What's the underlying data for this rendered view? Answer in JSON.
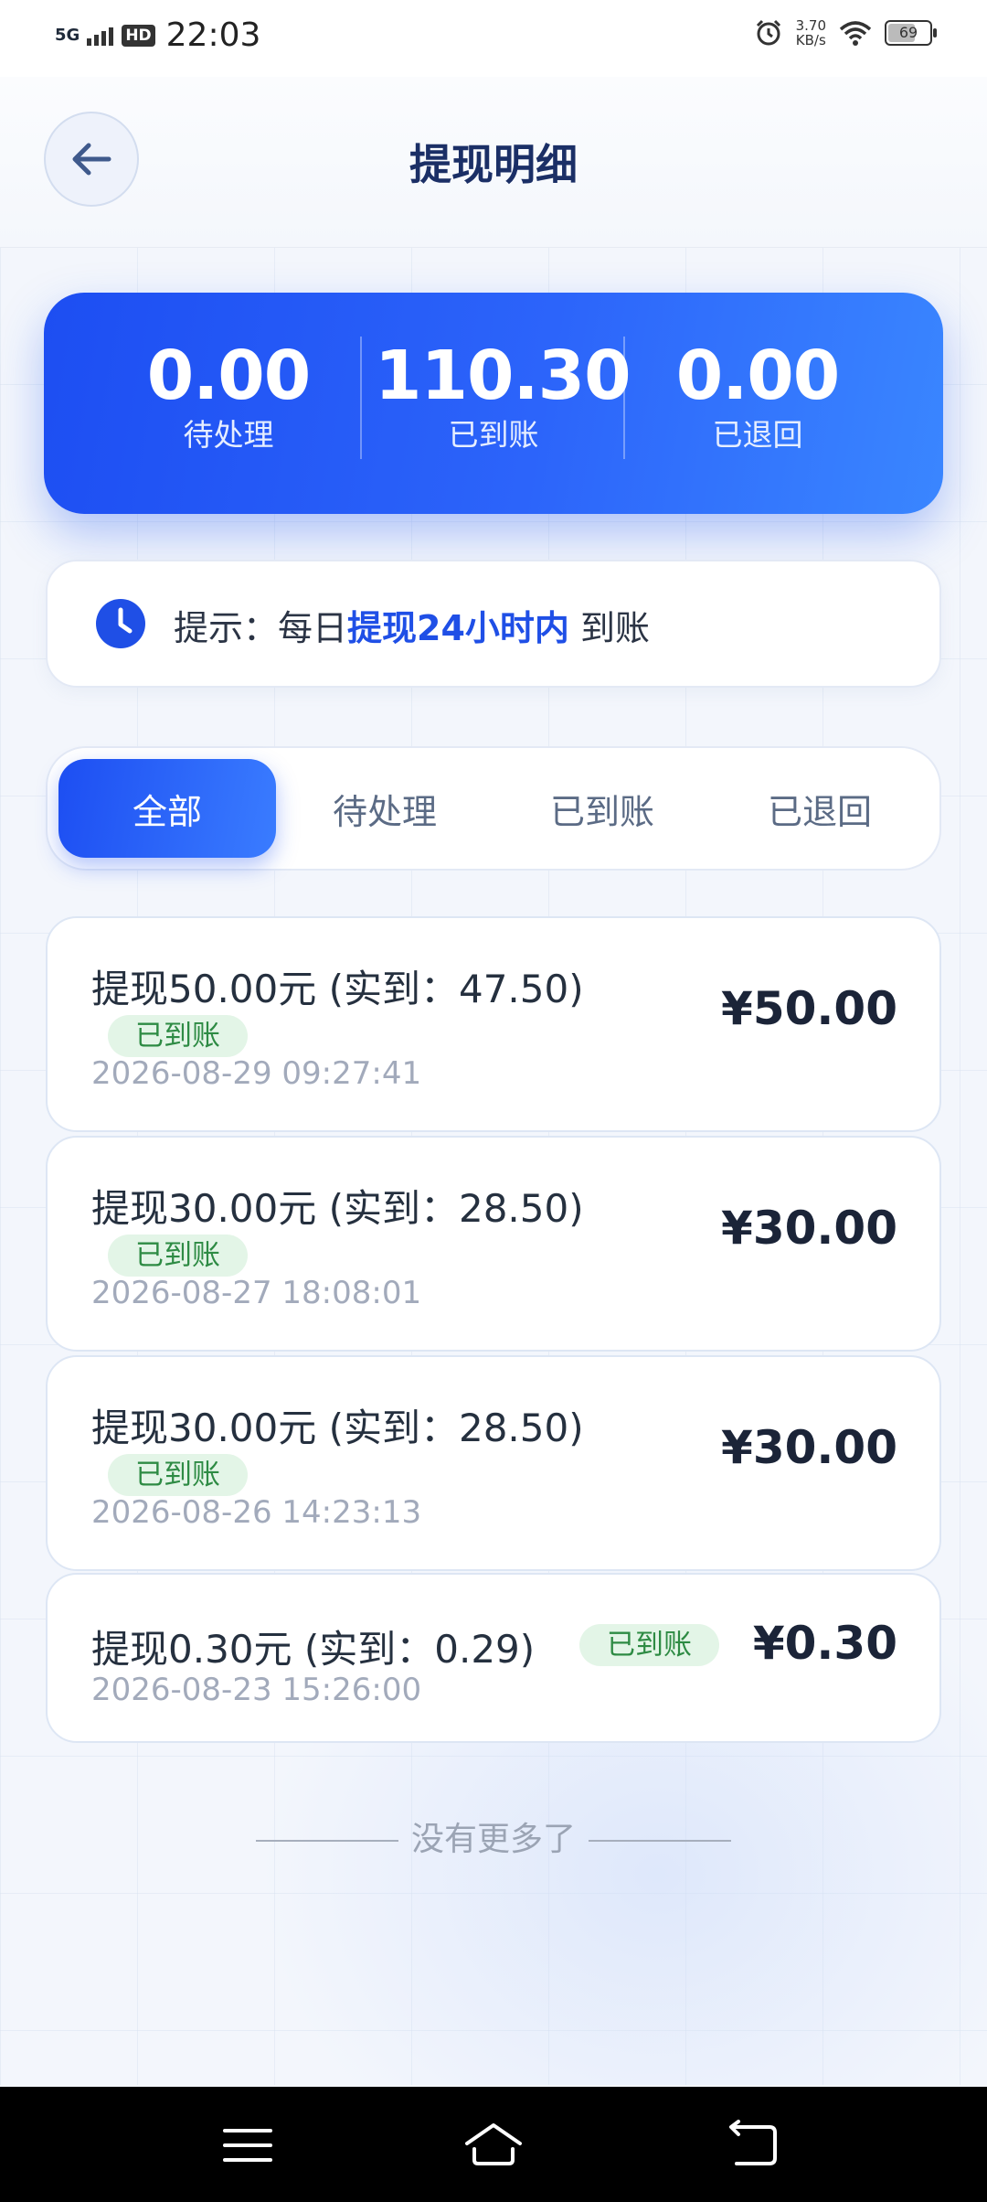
{
  "status_bar": {
    "network": "5G",
    "hd": "HD",
    "time": "22:03",
    "speed_value": "3.70",
    "speed_unit": "KB/s",
    "battery": "69"
  },
  "header": {
    "title": "提现明细"
  },
  "summary": {
    "pending": {
      "value": "0.00",
      "label": "待处理"
    },
    "received": {
      "value": "110.30",
      "label": "已到账"
    },
    "returned": {
      "value": "0.00",
      "label": "已退回"
    }
  },
  "tip": {
    "prefix": "提示：每日",
    "highlight": "提现24小时内",
    "suffix": " 到账"
  },
  "tabs": [
    {
      "label": "全部",
      "active": true
    },
    {
      "label": "待处理",
      "active": false
    },
    {
      "label": "已到账",
      "active": false
    },
    {
      "label": "已退回",
      "active": false
    }
  ],
  "records": [
    {
      "title": "提现50.00元 (实到：47.50)",
      "status": "已到账",
      "time": "2026-08-29 09:27:41",
      "amount": "¥50.00"
    },
    {
      "title": "提现30.00元 (实到：28.50)",
      "status": "已到账",
      "time": "2026-08-27 18:08:01",
      "amount": "¥30.00"
    },
    {
      "title": "提现30.00元 (实到：28.50)",
      "status": "已到账",
      "time": "2026-08-26 14:23:13",
      "amount": "¥30.00"
    },
    {
      "title": "提现0.30元 (实到：0.29)",
      "status": "已到账",
      "time": "2026-08-23 15:26:00",
      "amount": "¥0.30"
    }
  ],
  "footer": {
    "no_more": "没有更多了"
  },
  "colors": {
    "primary": "#1f4fe6",
    "success_bg": "#e3f5e7",
    "success_text": "#2e8b44"
  }
}
